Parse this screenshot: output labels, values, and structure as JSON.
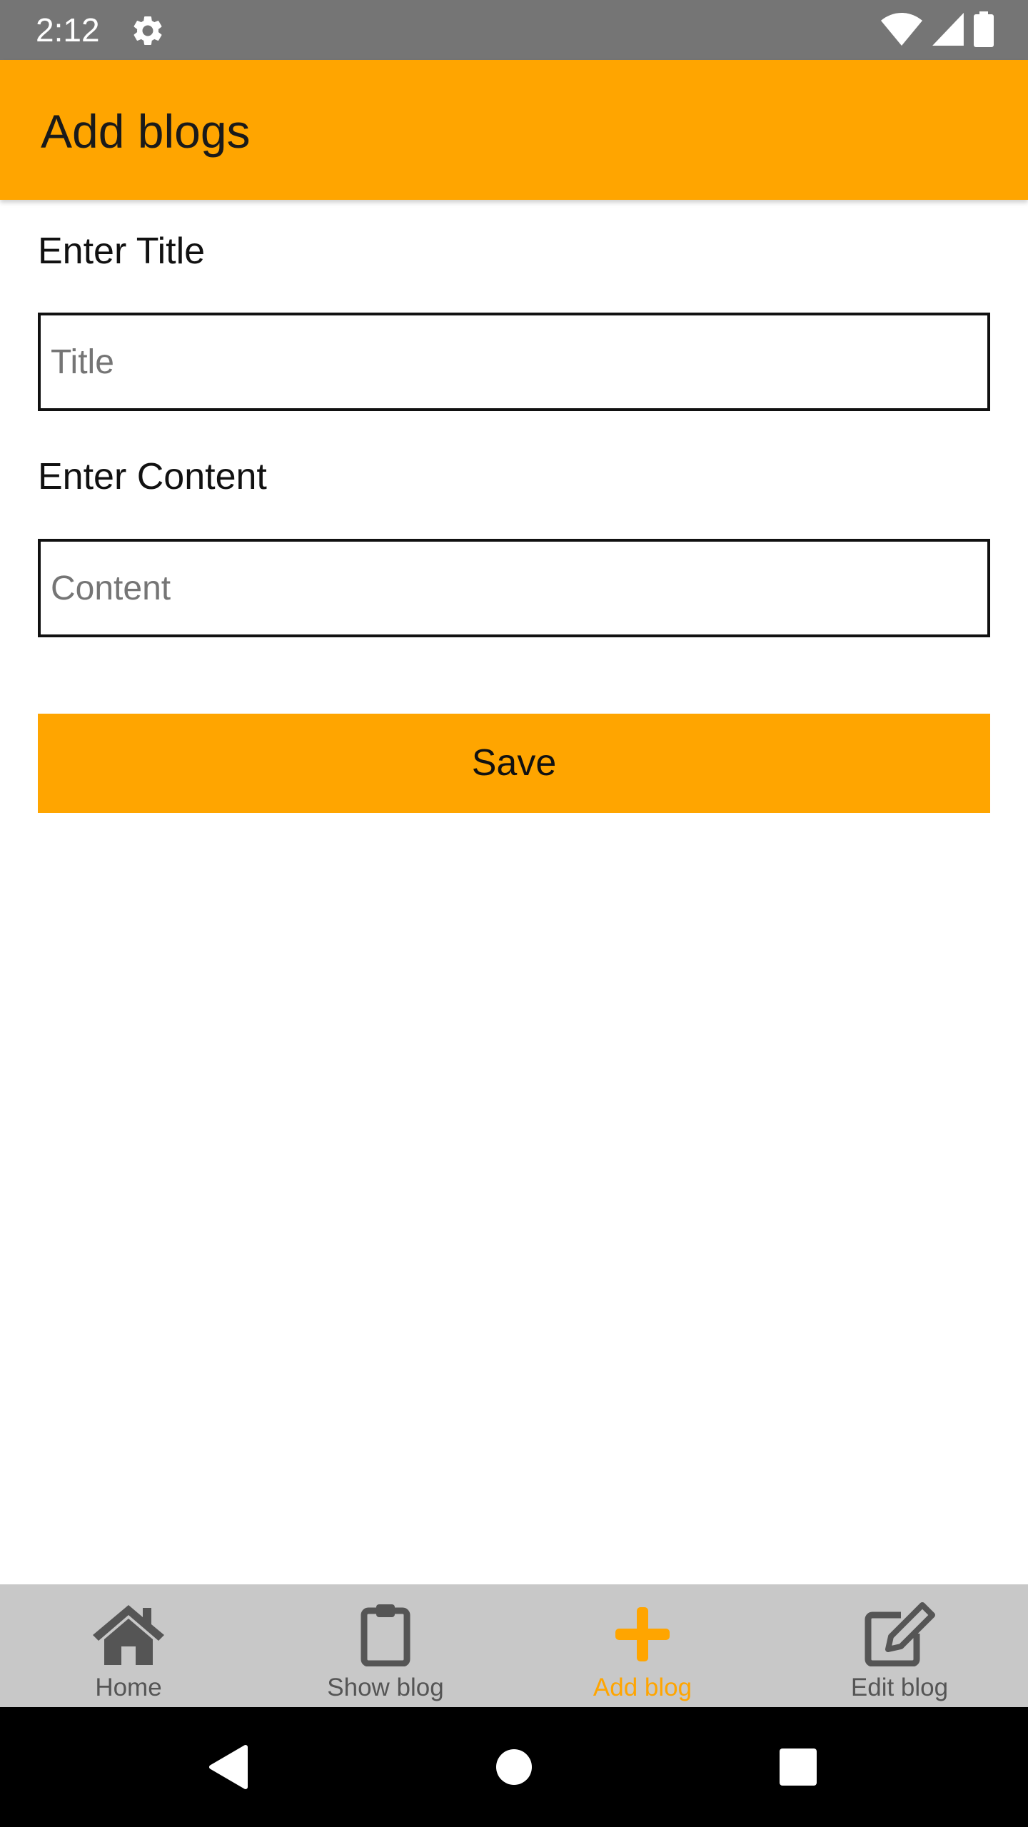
{
  "status_bar": {
    "time": "2:12",
    "icons": [
      "gear-icon",
      "wifi-icon",
      "cell-signal-icon",
      "battery-icon"
    ]
  },
  "app_bar": {
    "title": "Add blogs"
  },
  "form": {
    "title_label": "Enter Title",
    "title_input": {
      "value": "",
      "placeholder": "Title"
    },
    "content_label": "Enter Content",
    "content_input": {
      "value": "",
      "placeholder": "Content"
    },
    "save_label": "Save"
  },
  "bottom_nav": {
    "items": [
      {
        "label": "Home",
        "icon": "home-icon",
        "active": false
      },
      {
        "label": "Show blog",
        "icon": "clipboard-icon",
        "active": false
      },
      {
        "label": "Add blog",
        "icon": "plus-icon",
        "active": true
      },
      {
        "label": "Edit blog",
        "icon": "edit-icon",
        "active": false
      }
    ]
  },
  "system_nav": {
    "icons": [
      "back-icon",
      "home-circle-icon",
      "recents-icon"
    ]
  },
  "colors": {
    "accent": "#ffa500",
    "status_bar": "#757575",
    "nav_background": "#c8c8c8",
    "nav_inactive": "#555555"
  }
}
